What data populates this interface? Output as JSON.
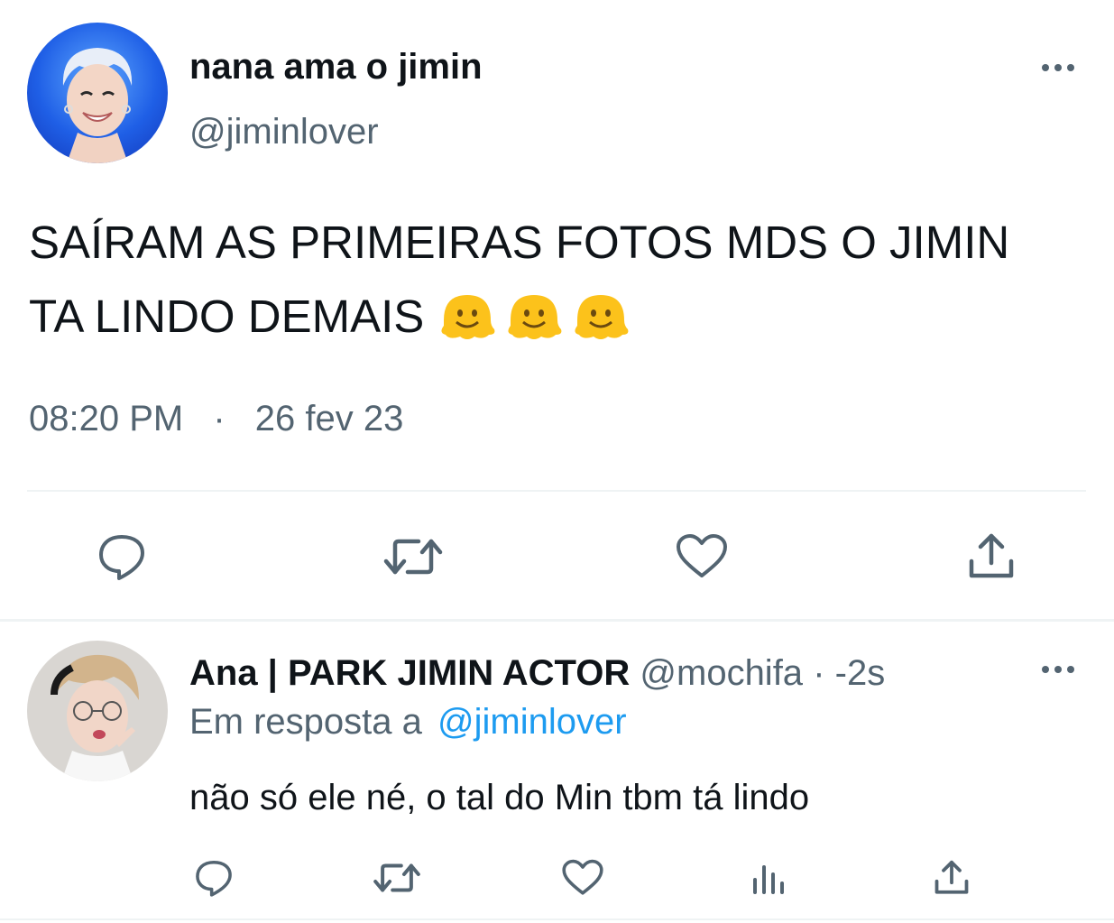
{
  "tweet": {
    "display_name": "nana ama o jimin",
    "handle": "@jiminlover",
    "text_line1": "SAÍRAM AS PRIMEIRAS FOTOS MDS O JIMIN",
    "text_line2": "TA LINDO DEMAIS",
    "emoji": [
      "melting-face",
      "melting-face",
      "melting-face"
    ],
    "time": "08:20 PM",
    "separator": "·",
    "date": "26 fev 23",
    "actions": [
      "reply-icon",
      "retweet-icon",
      "like-icon",
      "share-icon"
    ]
  },
  "reply": {
    "display_name": "Ana | PARK JIMIN ACTOR",
    "handle": "@mochifa",
    "time": "· -2s",
    "in_reply_prefix": "Em resposta a",
    "in_reply_handle": "@jiminlover",
    "text": "não só ele né, o tal do Min tbm tá lindo",
    "actions": [
      "reply-icon",
      "retweet-icon",
      "like-icon",
      "analytics-icon",
      "share-icon"
    ]
  },
  "colors": {
    "text": "#0f1419",
    "secondary": "#536471",
    "link": "#1d9bf0",
    "divider": "#eff3f4",
    "icon": "#536471",
    "emoji": "#fcc21b"
  }
}
